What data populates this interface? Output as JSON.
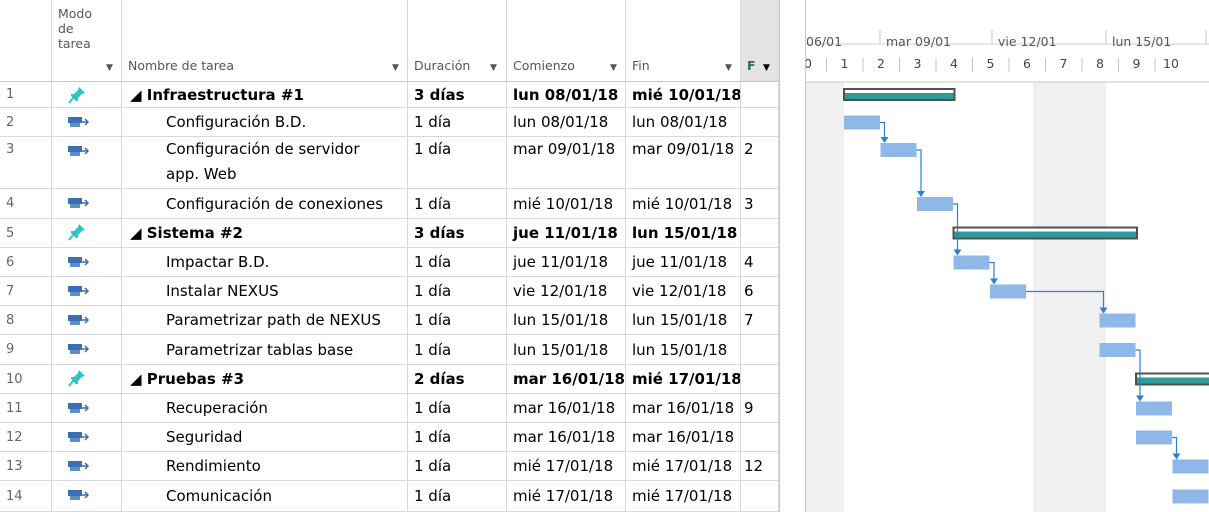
{
  "columns": {
    "mode": "Modo\nde\ntarea",
    "name": "Nombre de tarea",
    "duration": "Duración",
    "start": "Comienzo",
    "end": "Fin",
    "pred": "F"
  },
  "rows": [
    {
      "id": "1",
      "type": "summary",
      "name": "◢ Infraestructura #1",
      "dur": "3 días",
      "start": "lun 08/01/18",
      "end": "mié 10/01/18",
      "pred": ""
    },
    {
      "id": "2",
      "type": "task",
      "name": "Configuración B.D.",
      "dur": "1 día",
      "start": "lun 08/01/18",
      "end": "lun 08/01/18",
      "pred": ""
    },
    {
      "id": "3",
      "type": "task",
      "name": "Configuración de servidor",
      "name2": "app. Web",
      "dur": "1 día",
      "start": "mar 09/01/18",
      "end": "mar 09/01/18",
      "pred": "2"
    },
    {
      "id": "4",
      "type": "task",
      "name": "Configuración de conexiones",
      "dur": "1 día",
      "start": "mié 10/01/18",
      "end": "mié 10/01/18",
      "pred": "3"
    },
    {
      "id": "5",
      "type": "summary",
      "name": "◢ Sistema #2",
      "dur": "3 días",
      "start": "jue 11/01/18",
      "end": "lun 15/01/18",
      "pred": ""
    },
    {
      "id": "6",
      "type": "task",
      "name": "Impactar B.D.",
      "dur": "1 día",
      "start": "jue 11/01/18",
      "end": "jue 11/01/18",
      "pred": "4"
    },
    {
      "id": "7",
      "type": "task",
      "name": "Instalar NEXUS",
      "dur": "1 día",
      "start": "vie 12/01/18",
      "end": "vie 12/01/18",
      "pred": "6"
    },
    {
      "id": "8",
      "type": "task",
      "name": "Parametrizar path de NEXUS",
      "dur": "1 día",
      "start": "lun 15/01/18",
      "end": "lun 15/01/18",
      "pred": "7"
    },
    {
      "id": "9",
      "type": "task",
      "name": "Parametrizar tablas base",
      "dur": "1 día",
      "start": "lun 15/01/18",
      "end": "lun 15/01/18",
      "pred": ""
    },
    {
      "id": "10",
      "type": "summary",
      "name": "◢ Pruebas #3",
      "dur": "2 días",
      "start": "mar 16/01/18",
      "end": "mié 17/01/18",
      "pred": ""
    },
    {
      "id": "11",
      "type": "task",
      "name": "Recuperación",
      "dur": "1 día",
      "start": "mar 16/01/18",
      "end": "mar 16/01/18",
      "pred": "9"
    },
    {
      "id": "12",
      "type": "task",
      "name": "Seguridad",
      "dur": "1 día",
      "start": "mar 16/01/18",
      "end": "mar 16/01/18",
      "pred": ""
    },
    {
      "id": "13",
      "type": "task",
      "name": "Rendimiento",
      "dur": "1 día",
      "start": "mié 17/01/18",
      "end": "mié 17/01/18",
      "pred": "12"
    },
    {
      "id": "14",
      "type": "task",
      "name": "Comunicación",
      "dur": "1 día",
      "start": "mié 17/01/18",
      "end": "mié 17/01/18",
      "pred": ""
    }
  ],
  "timeline": {
    "top": [
      "06/01",
      "mar 09/01",
      "vie 12/01",
      "lun 15/01"
    ],
    "ticks": [
      "0",
      "1",
      "2",
      "3",
      "4",
      "5",
      "6",
      "7",
      "8",
      "9",
      "10"
    ]
  },
  "colors": {
    "task_bar": "#8fb8e8",
    "summary_bar": "#2e9b9b",
    "summary_border": "#505050",
    "link": "#2f7fd1",
    "pin": "#2ec4c4",
    "auto": "#3b6fb5"
  }
}
